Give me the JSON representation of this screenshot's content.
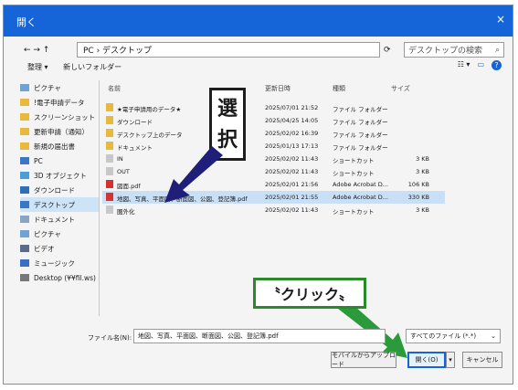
{
  "window": {
    "title": "開く",
    "close": "×"
  },
  "addressbar": {
    "path": "PC › デスクトップ",
    "search_placeholder": "デスクトップの検索"
  },
  "toolbar": {
    "organize": "整理 ▾",
    "new_folder": "新しいフォルダー"
  },
  "nav": {
    "items": [
      {
        "label": "ピクチャ",
        "icon": "pictures-icon"
      },
      {
        "label": "!電子申請データ",
        "icon": "folder-icon"
      },
      {
        "label": "スクリーンショット",
        "icon": "folder-icon"
      },
      {
        "label": "更新申請（通知）",
        "icon": "folder-icon"
      },
      {
        "label": "新規の届出書",
        "icon": "folder-icon"
      },
      {
        "label": "PC",
        "icon": "pc-icon"
      },
      {
        "label": "3D オブジェクト",
        "icon": "3d-objects-icon"
      },
      {
        "label": "ダウンロード",
        "icon": "download-icon"
      },
      {
        "label": "デスクトップ",
        "icon": "desktop-icon"
      },
      {
        "label": "ドキュメント",
        "icon": "documents-icon"
      },
      {
        "label": "ピクチャ",
        "icon": "pictures-icon"
      },
      {
        "label": "ビデオ",
        "icon": "video-icon"
      },
      {
        "label": "ミュージック",
        "icon": "music-icon"
      },
      {
        "label": "Desktop (¥¥fil.ws)",
        "icon": "network-drive-icon"
      }
    ]
  },
  "columns": {
    "name": "名前",
    "date": "更新日時",
    "type": "種類",
    "size": "サイズ"
  },
  "files": [
    {
      "name": "★電子申請用のデータ★",
      "date": "2025/07/01 21:52",
      "type": "ファイル フォルダー",
      "size": "",
      "icon": "folder-icon"
    },
    {
      "name": "ダウンロード",
      "date": "2025/04/25 14:05",
      "type": "ファイル フォルダー",
      "size": "",
      "icon": "folder-icon"
    },
    {
      "name": "デスクトップ上のデータ",
      "date": "2025/02/02 16:39",
      "type": "ファイル フォルダー",
      "size": "",
      "icon": "folder-icon"
    },
    {
      "name": "ドキュメント",
      "date": "2025/01/13 17:13",
      "type": "ファイル フォルダー",
      "size": "",
      "icon": "folder-icon"
    },
    {
      "name": "IN",
      "date": "2025/02/02 11:43",
      "type": "ショートカット",
      "size": "3 KB",
      "icon": "shortcut-icon"
    },
    {
      "name": "OUT",
      "date": "2025/02/02 11:43",
      "type": "ショートカット",
      "size": "3 KB",
      "icon": "shortcut-icon"
    },
    {
      "name": "図面.pdf",
      "date": "2025/02/01 21:56",
      "type": "Adobe Acrobat D...",
      "size": "106 KB",
      "icon": "pdf-icon"
    },
    {
      "name": "地図、写真、平面図、断面図、公図、登記簿.pdf",
      "date": "2025/02/01 21:55",
      "type": "Adobe Acrobat D...",
      "size": "330 KB",
      "icon": "pdf-icon"
    },
    {
      "name": "圏外化",
      "date": "2025/02/02 11:43",
      "type": "ショートカット",
      "size": "3 KB",
      "icon": "shortcut-icon"
    }
  ],
  "bottom": {
    "filename_label": "ファイル名(N):",
    "filename_value": "地図、写真、平面図、断面図、公図、登記簿.pdf",
    "filter": "すべてのファイル (*.*)",
    "upload_button": "モバイルからアップロード",
    "open_button": "開く(O)",
    "cancel_button": "キャンセル"
  },
  "annotations": {
    "select_text": "選択",
    "click_text": "〝クリック〟"
  },
  "colors": {
    "accent": "#1565d8",
    "select_bg": "#c9dff5",
    "arrow_dark": "#1f1f7a",
    "arrow_green": "#2a9a3a"
  }
}
